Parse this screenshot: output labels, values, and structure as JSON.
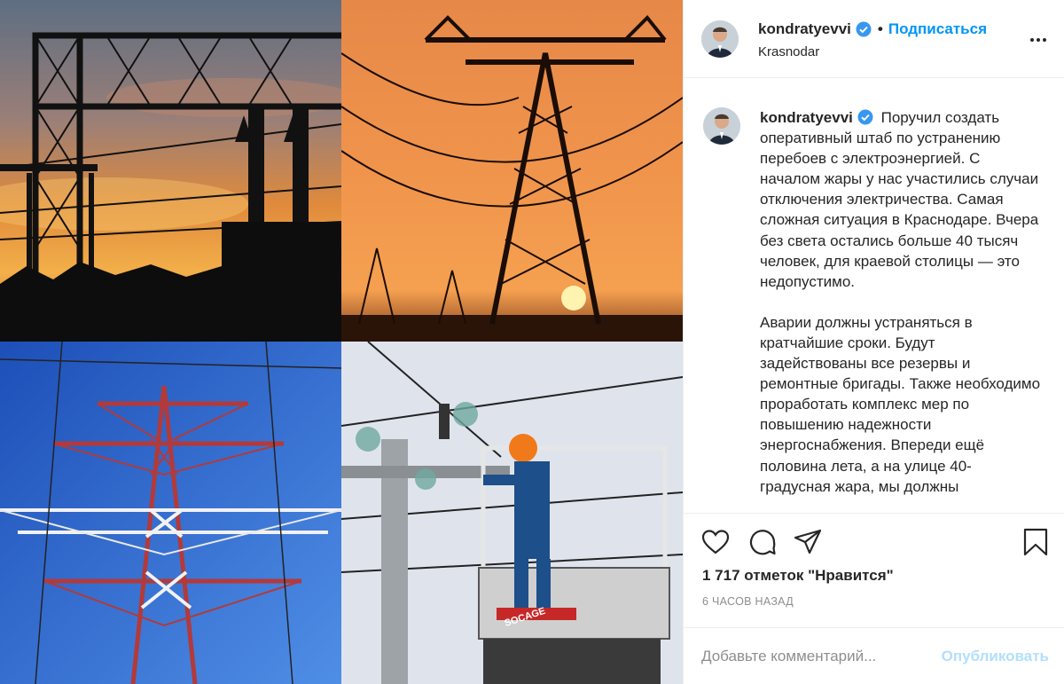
{
  "post": {
    "username": "kondratyevvi",
    "follow_label": "Подписаться",
    "location": "Krasnodar",
    "caption_paragraphs": [
      "Поручил создать оперативный штаб по устранению перебоев с электроэнергией. С началом жары у нас участились случаи отключения электричества. Самая сложная ситуация в Краснодаре. Вчера без света остались больше 40 тысяч человек, для краевой столицы — это недопустимо.",
      "Аварии должны устраняться в кратчайшие сроки. Будут задействованы все резервы и ремонтные бригады. Также необходимо проработать комплекс мер по повышению надежности энергоснабжения. Впереди ещё половина лета, а на улице 40-градусная жара, мы должны"
    ],
    "likes_text": "1 717 отметок \"Нравится\"",
    "time_text": "6 ЧАСОВ НАЗАД",
    "comment_placeholder": "Добавьте комментарий...",
    "publish_label": "Опубликовать",
    "bucket_label": "SOCAGE"
  },
  "icons": {
    "verified": "verified-badge-icon",
    "more": "more-options-icon",
    "like": "heart-icon",
    "comment": "comment-bubble-icon",
    "share": "paper-plane-icon",
    "save": "bookmark-icon"
  },
  "colors": {
    "accent": "#0095f6",
    "publish_disabled": "#b2dffc",
    "muted": "#8e8e8e",
    "text": "#262626",
    "divider": "#efefef"
  }
}
